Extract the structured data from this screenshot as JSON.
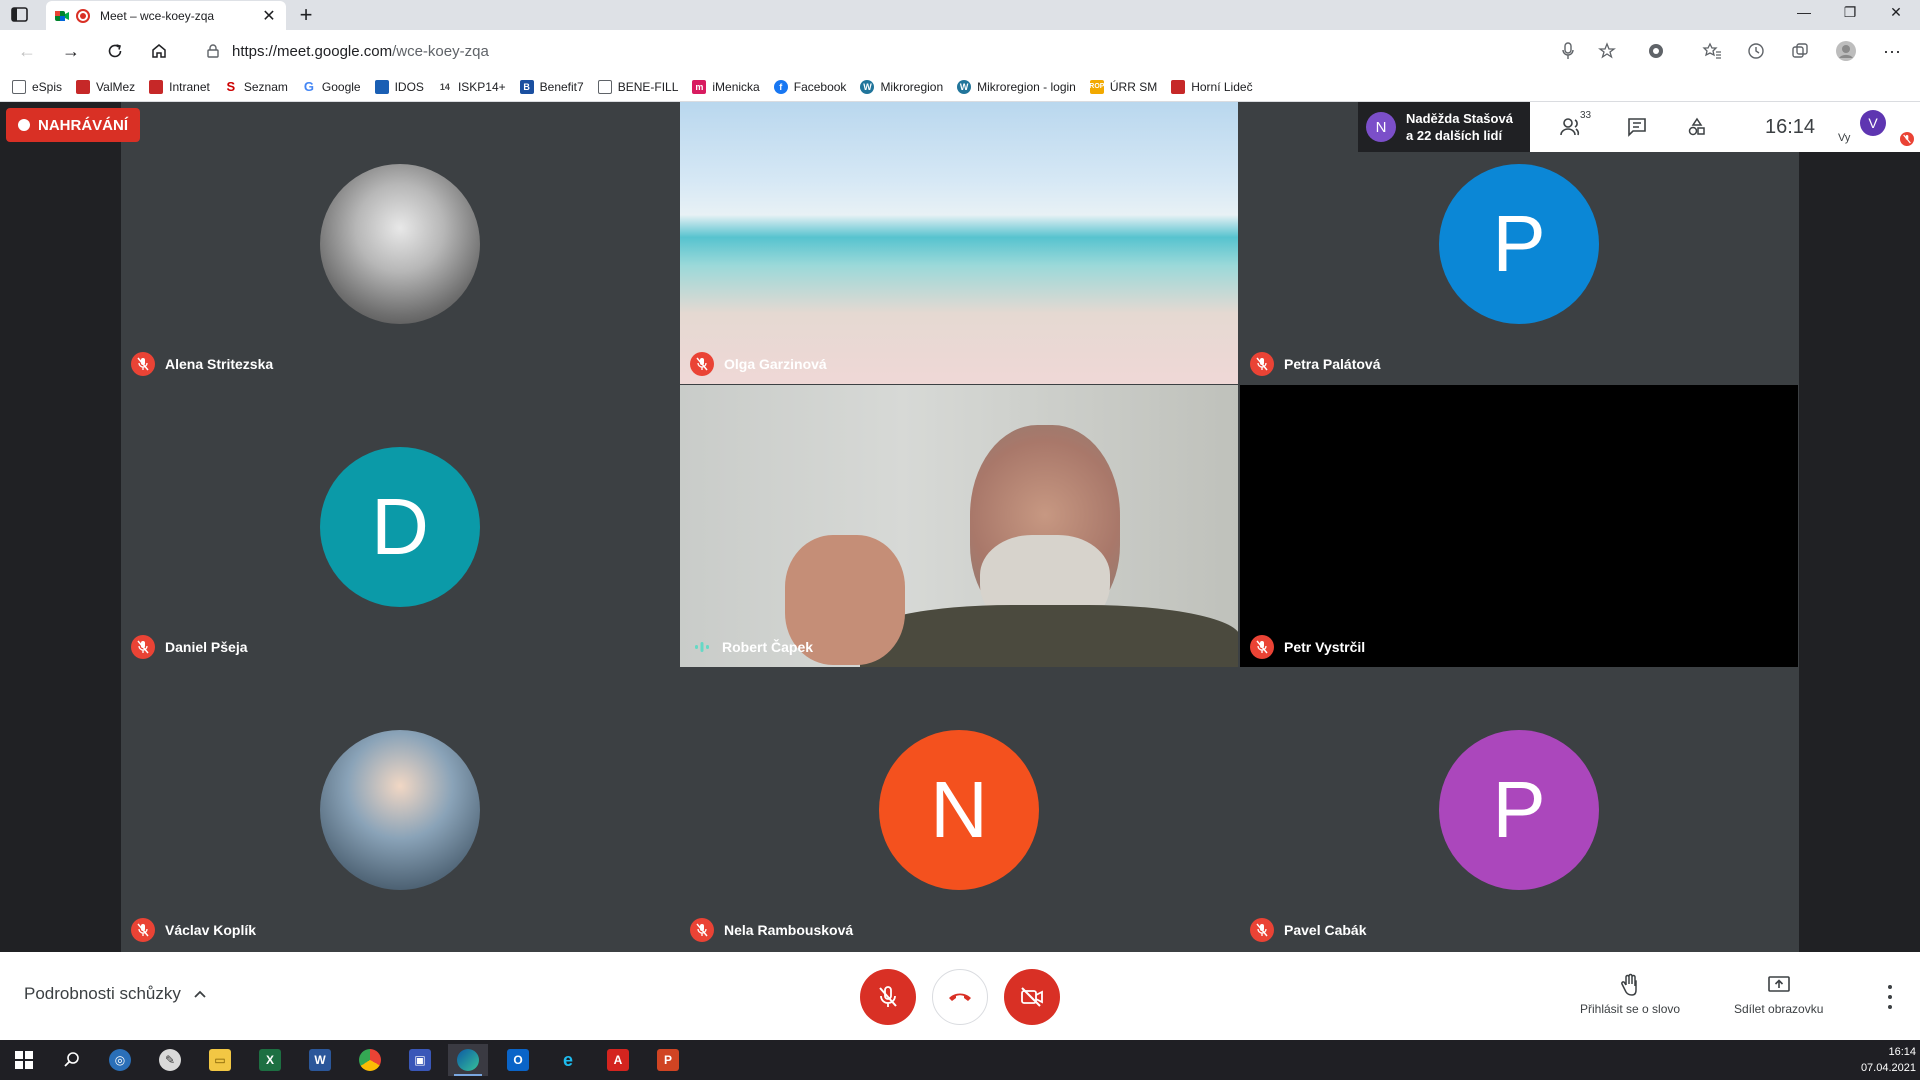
{
  "browser": {
    "tab_title": "Meet – wce-koey-zqa",
    "url_host": "https://meet.google.com",
    "url_path": "/wce-koey-zqa",
    "bookmarks": [
      {
        "label": "eSpis",
        "color": "#5f6368"
      },
      {
        "label": "ValMez",
        "color": "#c62828"
      },
      {
        "label": "Intranet",
        "color": "#c62828"
      },
      {
        "label": "Seznam",
        "color": "#cc0000"
      },
      {
        "label": "Google",
        "color": "#4285f4"
      },
      {
        "label": "IDOS",
        "color": "#1a5fb4"
      },
      {
        "label": "ISKP14+",
        "color": "#444444"
      },
      {
        "label": "Benefit7",
        "color": "#1a4fa0"
      },
      {
        "label": "BENE-FILL",
        "color": "#5f6368"
      },
      {
        "label": "iMenicka",
        "color": "#d81b60"
      },
      {
        "label": "Facebook",
        "color": "#1877f2"
      },
      {
        "label": "Mikroregion",
        "color": "#21759b"
      },
      {
        "label": "Mikroregion - login",
        "color": "#21759b"
      },
      {
        "label": "ÚRR SM",
        "color": "#f2a900"
      },
      {
        "label": "Horní Lideč",
        "color": "#c62828"
      }
    ]
  },
  "meet": {
    "recording_label": "NAHRÁVÁNÍ",
    "joiner": {
      "initial": "N",
      "line1": "Naděžda Stašová",
      "line2": "a 22 dalších lidí"
    },
    "participant_count": "33",
    "time": "16:14",
    "self_label": "Vy",
    "self_initial": "V",
    "colors": {
      "recording": "#d93025",
      "mic_off": "#ea4335",
      "speaking": "#66d9c5"
    },
    "tiles": [
      {
        "name": "Alena Stritezska",
        "type": "photo-f",
        "mic": "off"
      },
      {
        "name": "Olga Garzinová",
        "type": "beach",
        "mic": "off"
      },
      {
        "name": "Petra Palátová",
        "type": "avatar",
        "initial": "P",
        "color": "#0b87d6",
        "mic": "off"
      },
      {
        "name": "Daniel Pšeja",
        "type": "avatar",
        "initial": "D",
        "color": "#0b9aa8",
        "mic": "off"
      },
      {
        "name": "Robert Čapek",
        "type": "video",
        "mic": "speaking"
      },
      {
        "name": "Petr Vystrčil",
        "type": "dark",
        "mic": "off"
      },
      {
        "name": "Václav Koplík",
        "type": "photo-m",
        "mic": "off"
      },
      {
        "name": "Nela Rambousková",
        "type": "avatar",
        "initial": "N",
        "color": "#f4511e",
        "mic": "off"
      },
      {
        "name": "Pavel Cabák",
        "type": "avatar",
        "initial": "P",
        "color": "#ab47bc",
        "mic": "off"
      }
    ]
  },
  "bottom": {
    "details_label": "Podrobnosti schůzky",
    "raise_hand_label": "Přihlásit se o slovo",
    "present_label": "Sdílet obrazovku"
  },
  "taskbar": {
    "time": "16:14",
    "date": "07.04.2021"
  }
}
